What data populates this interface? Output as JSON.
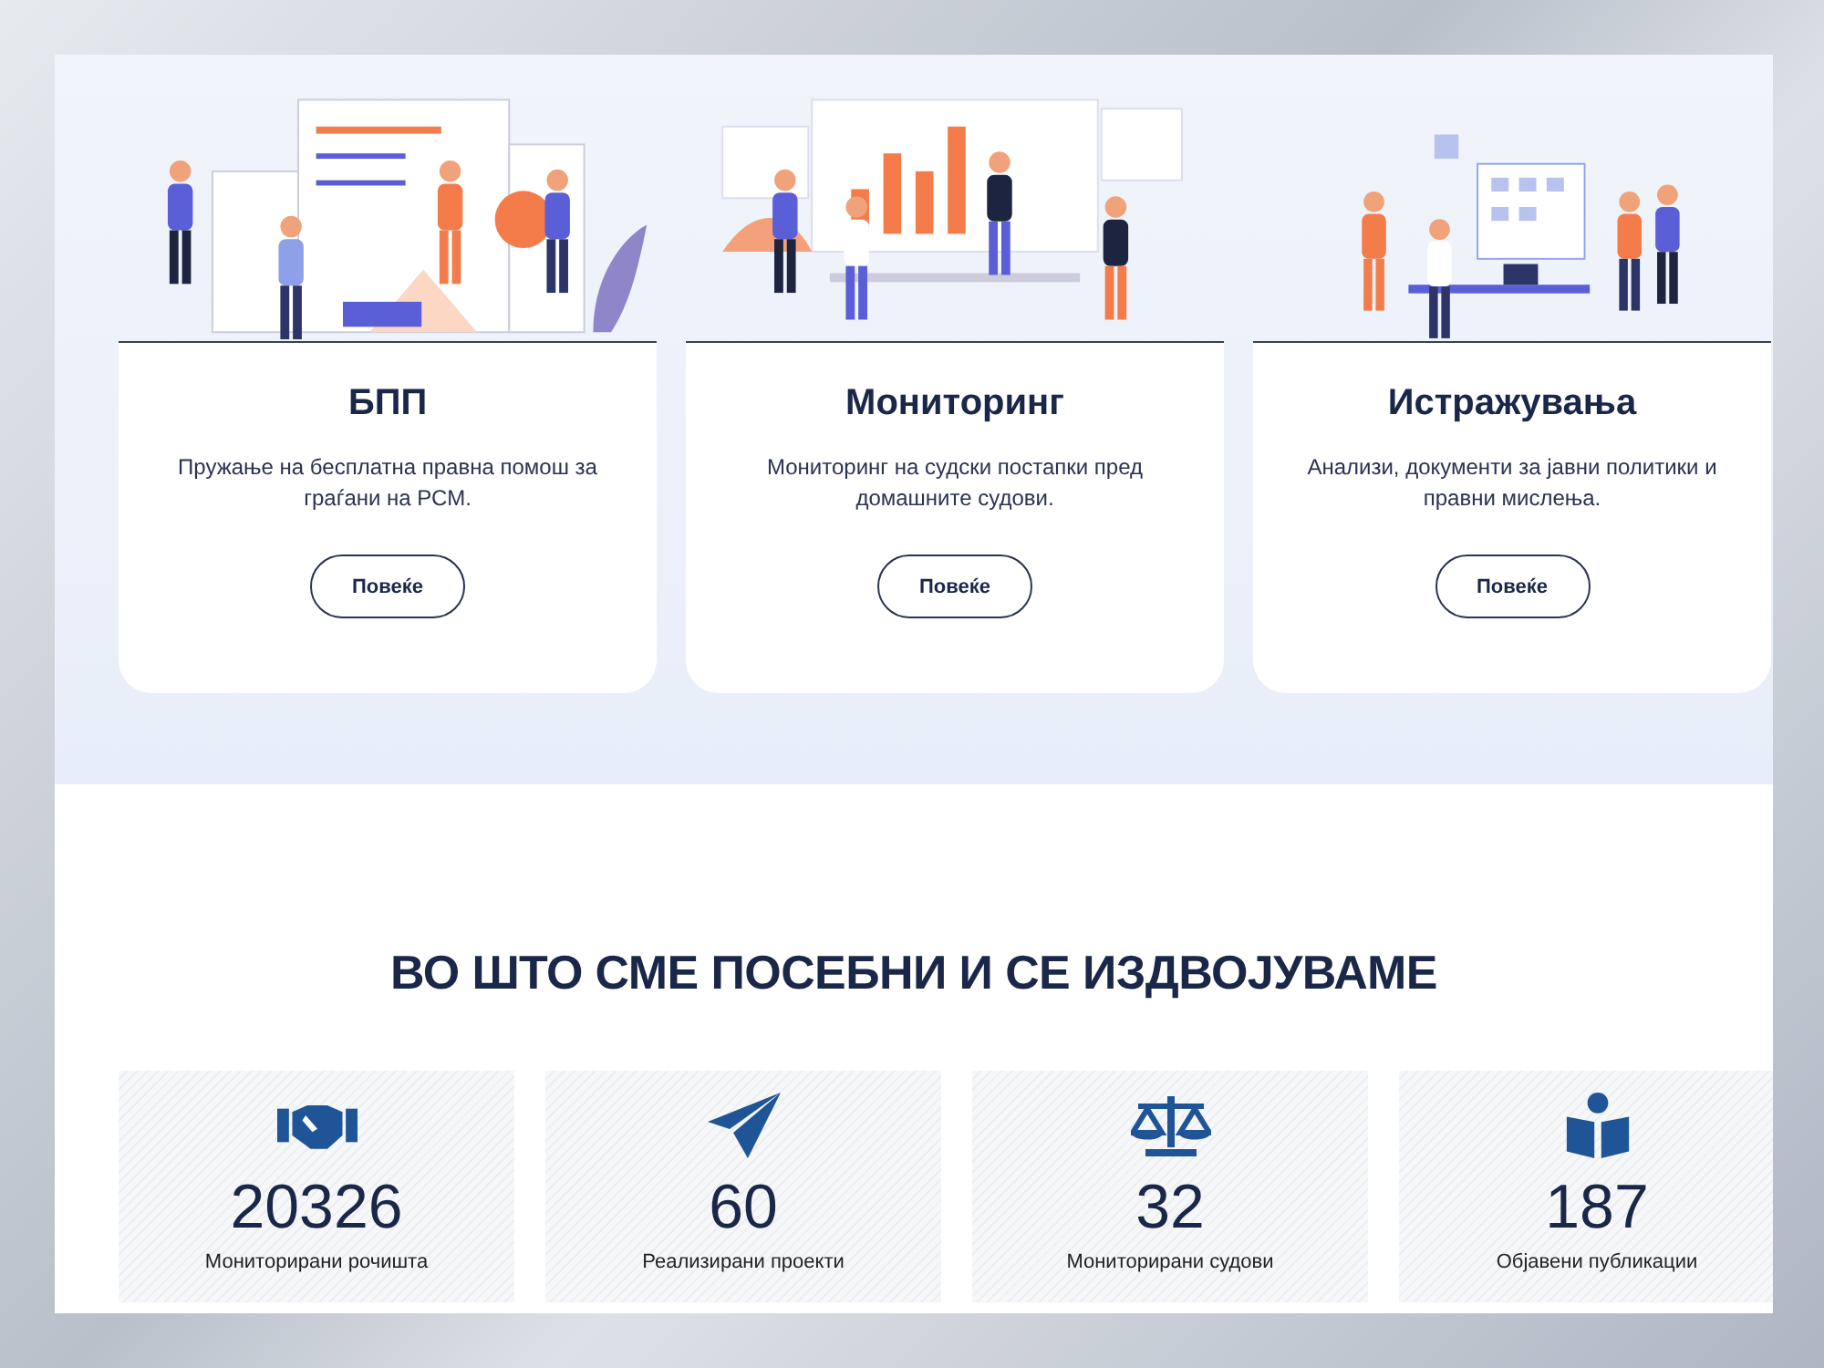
{
  "services": [
    {
      "title": "БПП",
      "description": "Пружање на бесплатна правна помош за граѓани на РСМ.",
      "button": "Повеќе"
    },
    {
      "title": "Мониторинг",
      "description": "Мониторинг на судски постапки пред домашните судови.",
      "button": "Повеќе"
    },
    {
      "title": "Истражувања",
      "description": "Анализи, документи за јавни политики и правни мислења.",
      "button": "Повеќе"
    }
  ],
  "highlights": {
    "heading": "ВО ШТО СМЕ ПОСЕБНИ И СЕ ИЗДВОЈУВАМЕ",
    "stats": [
      {
        "value": "20326",
        "label": "Мониторирани рочишта"
      },
      {
        "value": "60",
        "label": "Реализирани проекти"
      },
      {
        "value": "32",
        "label": "Мониторирани судови"
      },
      {
        "value": "187",
        "label": "Објавени публикации"
      }
    ]
  }
}
